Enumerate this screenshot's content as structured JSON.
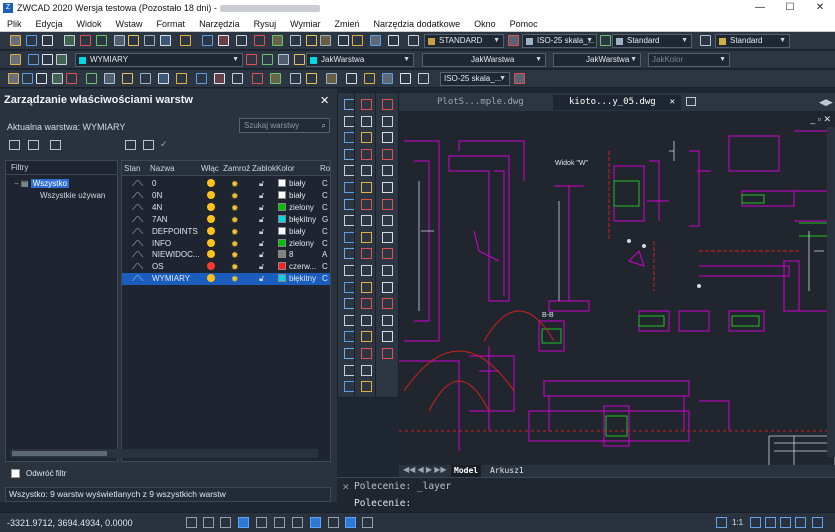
{
  "app": {
    "title": "ZWCAD 2020 Wersja testowa (Pozostało 18 dni) -",
    "window_controls": [
      "—",
      "☐",
      "✕"
    ]
  },
  "menu": [
    "Plik",
    "Edycja",
    "Widok",
    "Wstaw",
    "Format",
    "Narzędzia",
    "Rysuj",
    "Wymiar",
    "Zmień",
    "Narzędzia dodatkowe",
    "Okno",
    "Pomoc"
  ],
  "toolbar1": {
    "text_style": "STANDARD",
    "dim_style": "ISO-25 skala_...",
    "table_style": "Standard",
    "multileader_style": "Standard"
  },
  "toolbar2": {
    "layer": "WYMIARY",
    "color": "JakWarstwa",
    "linetype": "JakWarstwa",
    "lineweight": "JakWarstwa",
    "plotstyle": "JakKolor"
  },
  "toolbar3": {
    "dim_style": "ISO-25 skala_..."
  },
  "layer_panel": {
    "title": "Zarządzanie właściwościami warstw",
    "current_layer": "Aktualna warstwa: WYMIARY",
    "search_placeholder": "Szukaj warstwy",
    "filters_header": "Filtry",
    "filter_root": "Wszystko",
    "filter_sub": "Wszystkie używan",
    "columns": [
      "Stan",
      "Nazwa",
      "Włąc",
      "Zamroź",
      "Zablok",
      "Kolor",
      "Ro"
    ],
    "layers": [
      {
        "name": "0",
        "color_name": "biały",
        "color": "#ffffff",
        "lt": "C",
        "bulb": "on"
      },
      {
        "name": "0N",
        "color_name": "biały",
        "color": "#ffffff",
        "lt": "C",
        "bulb": "on"
      },
      {
        "name": "4N",
        "color_name": "zielony",
        "color": "#00c000",
        "lt": "C",
        "bulb": "on"
      },
      {
        "name": "7AN",
        "color_name": "błękitny",
        "color": "#00d7e6",
        "lt": "G",
        "bulb": "on"
      },
      {
        "name": "DEFPOINTS",
        "color_name": "biały",
        "color": "#ffffff",
        "lt": "C",
        "bulb": "on"
      },
      {
        "name": "INFO",
        "color_name": "zielony",
        "color": "#00c000",
        "lt": "C",
        "bulb": "on"
      },
      {
        "name": "NIEWIDOC...",
        "color_name": "8",
        "color": "#808080",
        "lt": "A",
        "bulb": "on"
      },
      {
        "name": "OS",
        "color_name": "czerw...",
        "color": "#ff2020",
        "lt": "C",
        "bulb": "off"
      },
      {
        "name": "WYMIARY",
        "color_name": "błękitny",
        "color": "#00d7e6",
        "lt": "C",
        "bulb": "on",
        "selected": true
      }
    ],
    "invert_filter": "Odwróć filtr",
    "status": "Wszystko: 9 warstw wyświetlanych z 9 wszystkich warstw"
  },
  "doc_tabs": [
    {
      "label": "PlotS...mple.dwg",
      "active": false
    },
    {
      "label": "kioto...y_05.dwg",
      "active": true
    }
  ],
  "layout_tabs": [
    "Model",
    "Arkusz1"
  ],
  "command": {
    "history": "Polecenie:  _layer",
    "prompt": "Polecenie:"
  },
  "drawing": {
    "label_widok": "Widok \"W\"",
    "label_bb": "B-B"
  },
  "status_bar": {
    "coords": "-3321.9712, 3694.4934, 0.0000",
    "scale": "1:1"
  },
  "colors": {
    "drawing_bg": "#21262e",
    "magenta": "#d000d0",
    "green": "#20c020",
    "red": "#ff2020",
    "accent_blue": "#1a5dbd"
  }
}
